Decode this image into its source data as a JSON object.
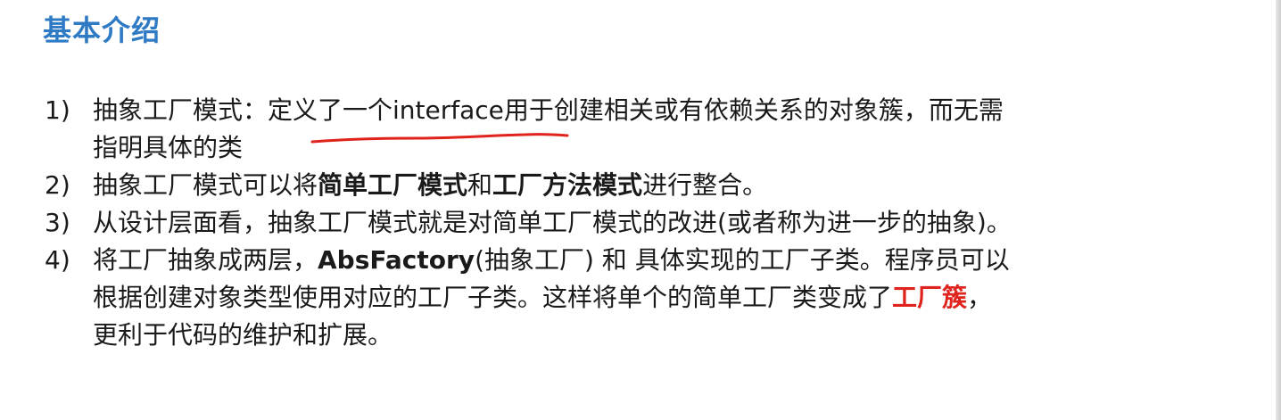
{
  "slide": {
    "title": "基本介绍"
  },
  "items": [
    {
      "number": "1)",
      "line1": "抽象工厂模式：定义了一个interface用于创建相关或有依赖关系的对象簇，而无需",
      "line2": "指明具体的类"
    },
    {
      "number": "2)",
      "part1": "抽象工厂模式可以将",
      "bold1": "简单工厂模式",
      "part2": "和",
      "bold2": "工厂方法模式",
      "part3": "进行整合。"
    },
    {
      "number": "3)",
      "text": "从设计层面看，抽象工厂模式就是对简单工厂模式的改进(或者称为进一步的抽象)。"
    },
    {
      "number": "4)",
      "line1_a": "将工厂抽象成两层，",
      "line1_bold": "AbsFactory",
      "line1_b": "(抽象工厂) 和 具体实现的工厂子类。程序员可以",
      "line2_a": "根据创建对象类型使用对应的工厂子类。这样将单个的简单工厂类变成了",
      "line2_red": "工厂簇",
      "line2_b": "，",
      "line3": "更利于代码的维护和扩展。"
    }
  ],
  "colors": {
    "title": "#2f7ac4",
    "highlight": "#e0231c",
    "annotation": "#e0231c"
  }
}
